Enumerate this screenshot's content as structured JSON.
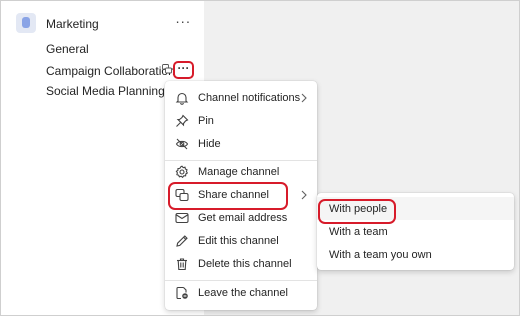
{
  "team": {
    "name": "Marketing",
    "more": "···"
  },
  "channels": [
    "General",
    "Campaign Collaboration",
    "Social Media Planning"
  ],
  "channel_more": "···",
  "menu": {
    "items": [
      "Channel notifications",
      "Pin",
      "Hide",
      "Manage channel",
      "Share channel",
      "Get email address",
      "Edit this channel",
      "Delete this channel",
      "Leave the channel"
    ]
  },
  "submenu": {
    "items": [
      "With people",
      "With a team",
      "With a team you own"
    ]
  },
  "colors": {
    "highlight": "#d71b2a",
    "text": "#242424",
    "accent": "#8aa4e6"
  },
  "icons": [
    "bell-icon",
    "pin-icon",
    "hide-icon",
    "gear-icon",
    "share-icon",
    "mail-icon",
    "pencil-icon",
    "trash-icon",
    "leave-icon"
  ]
}
